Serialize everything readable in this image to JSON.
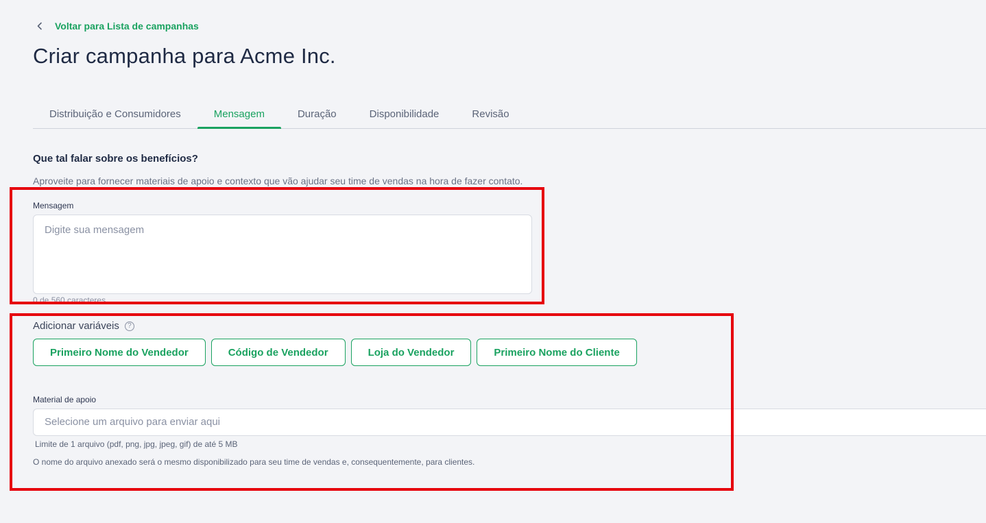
{
  "header": {
    "back_label": "Voltar para Lista de campanhas",
    "title": "Criar campanha para Acme Inc."
  },
  "tabs": [
    {
      "label": "Distribuição e Consumidores",
      "active": false
    },
    {
      "label": "Mensagem",
      "active": true
    },
    {
      "label": "Duração",
      "active": false
    },
    {
      "label": "Disponibilidade",
      "active": false
    },
    {
      "label": "Revisão",
      "active": false
    }
  ],
  "section": {
    "title": "Que tal falar sobre os benefícios?",
    "description": "Aproveite para fornecer materiais de apoio e contexto que vão ajudar seu time de vendas na hora de fazer contato."
  },
  "message": {
    "label": "Mensagem",
    "placeholder": "Digite sua mensagem",
    "value": "",
    "char_count": "0 de 560 caracteres"
  },
  "variables": {
    "label": "Adicionar variáveis",
    "help_icon": "question-circle-icon",
    "buttons": [
      "Primeiro Nome do Vendedor",
      "Código de Vendedor",
      "Loja do Vendedor",
      "Primeiro Nome do Cliente"
    ]
  },
  "support_material": {
    "label": "Material de apoio",
    "placeholder": "Selecione um arquivo para enviar aqui",
    "limit_hint": "Limite de 1 arquivo (pdf, png, jpg, jpeg, gif) de até 5 MB",
    "name_hint": "O nome do arquivo anexado será o mesmo disponibilizado para seu time de vendas e, consequentemente, para clientes."
  },
  "colors": {
    "accent": "#1aa260",
    "title": "#1f2a44",
    "highlight": "#e6000b",
    "background": "#f3f4f7"
  }
}
